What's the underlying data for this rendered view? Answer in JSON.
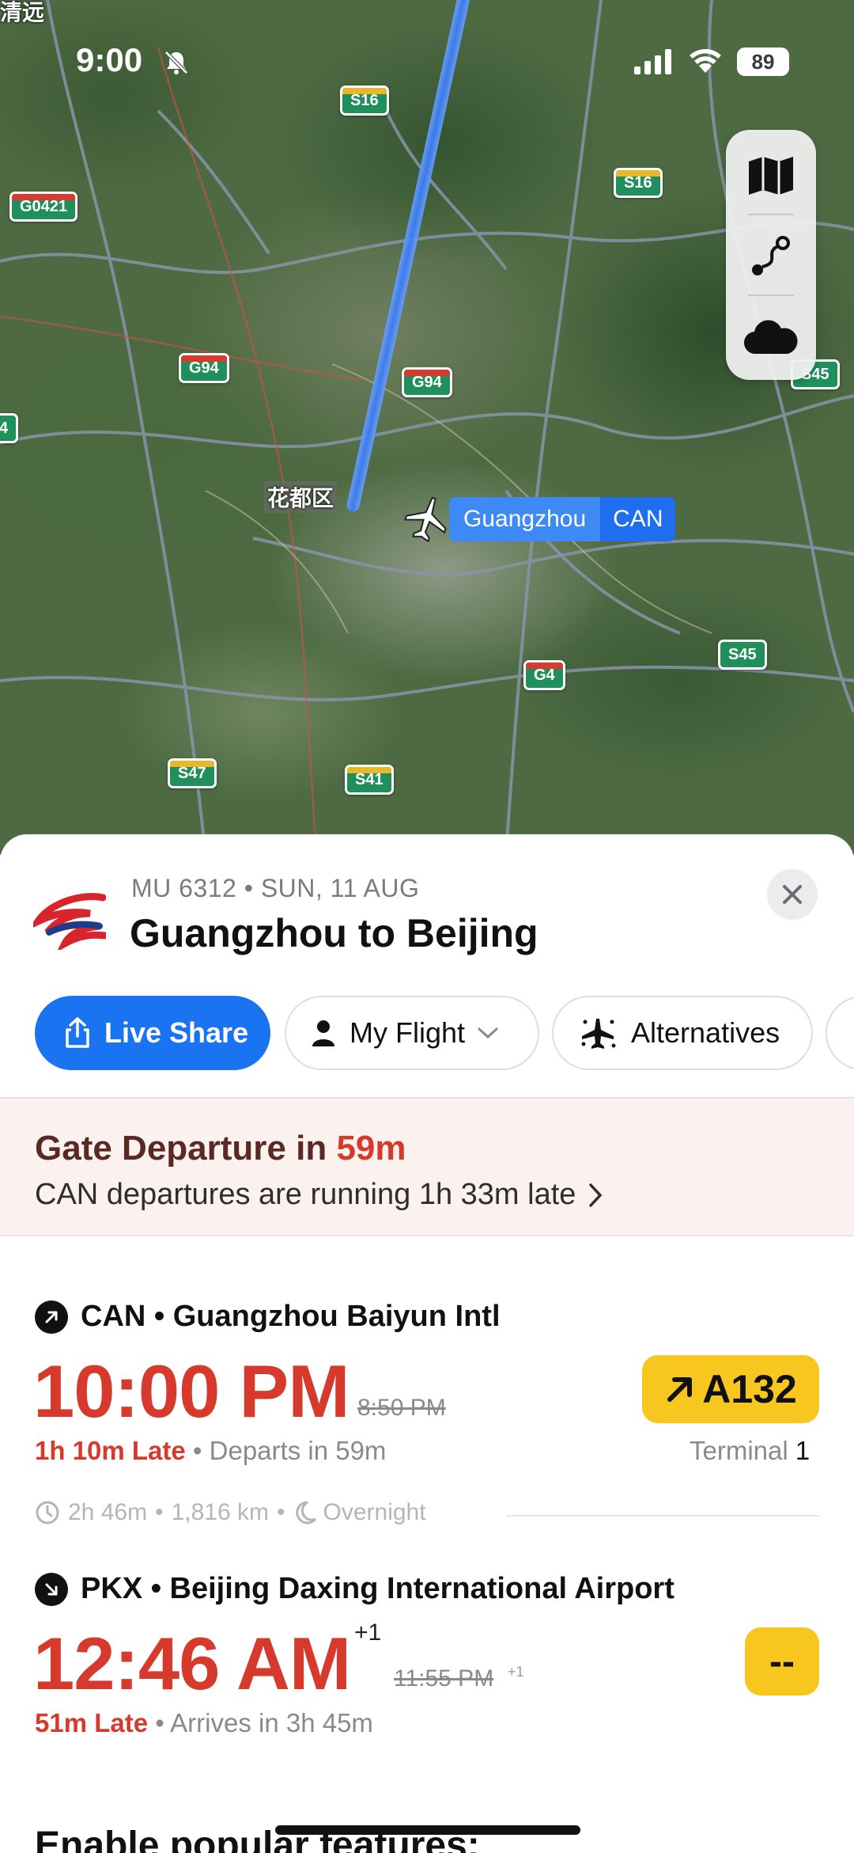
{
  "status_bar": {
    "time": "9:00",
    "battery": "89"
  },
  "map": {
    "airport_label": {
      "name": "Guangzhou",
      "code": "CAN"
    },
    "place_labels": [
      "清远",
      "花都区"
    ],
    "road_shields": [
      "S16",
      "S16",
      "G0421",
      "G94",
      "G94",
      "S45",
      "4",
      "G4",
      "S45",
      "S47",
      "S41"
    ],
    "controls": [
      "map-style-icon",
      "route-icon",
      "weather-icon"
    ]
  },
  "flight": {
    "meta": "MU 6312 • SUN, 11 AUG",
    "title": "Guangzhou to Beijing"
  },
  "actions": {
    "live_share": "Live Share",
    "my_flight": "My Flight",
    "alternatives": "Alternatives"
  },
  "alert": {
    "title_prefix": "Gate Departure in ",
    "title_value": "59m",
    "subtitle": "CAN departures are running 1h 33m late"
  },
  "departure": {
    "header": "CAN • Guangzhou Baiyun Intl",
    "time": "10:00 PM",
    "scheduled": "8:50 PM",
    "late": "1h 10m Late",
    "detail": " • Departs in 59m",
    "gate": "A132",
    "terminal_label": "Terminal ",
    "terminal_value": "1"
  },
  "stats": {
    "duration": "2h 46m",
    "distance": "1,816 km",
    "overnight": "Overnight"
  },
  "arrival": {
    "header": "PKX • Beijing Daxing International Airport",
    "time": "12:46 AM",
    "plus_day": "+1",
    "scheduled": "11:55 PM",
    "scheduled_plus_day": "+1",
    "late": "51m Late",
    "detail": " • Arrives in 3h 45m",
    "gate": "--"
  },
  "footer": {
    "heading": "Enable popular features:"
  },
  "colors": {
    "accent_blue": "#1a73f0",
    "late_red": "#d63a2c",
    "gate_yellow": "#f7c61f"
  }
}
